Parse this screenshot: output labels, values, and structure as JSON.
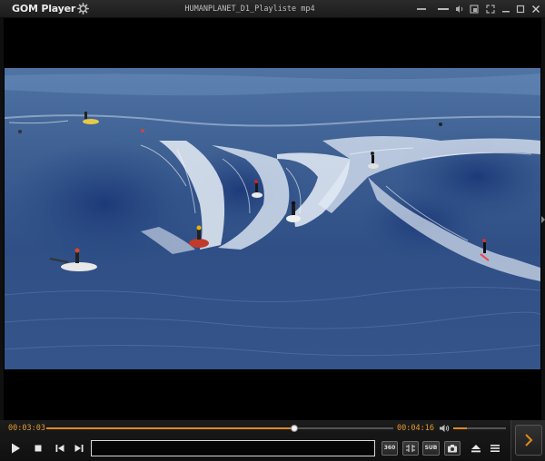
{
  "app": {
    "logo_text": "GOM Player",
    "file_title": "HUMANPLANET_D1_Playliste mp4"
  },
  "titlebar_icons": [
    "window-mode-icon",
    "audio-mode-icon",
    "picture-in-picture-icon",
    "mini-mode-icon",
    "minimize-icon",
    "maximize-icon",
    "close-icon"
  ],
  "playback": {
    "current_time": "00:03:03",
    "total_time": "00:04:16",
    "progress_fraction": 0.715,
    "volume_fraction": 0.25
  },
  "controls": {
    "playlist_value": "",
    "buttons": [
      "play-icon",
      "stop-icon",
      "previous-icon",
      "next-icon"
    ],
    "right_buttons": [
      "video-settings-icon",
      "audio-settings-icon",
      "subtitle-button",
      "screenshot-icon",
      "eject-icon",
      "menu-icon"
    ],
    "subtitle_label": "SUB",
    "settings_360_label": "360"
  },
  "colors": {
    "accent": "#e08a1f",
    "time_text": "#e39a2c",
    "background": "#000000"
  }
}
